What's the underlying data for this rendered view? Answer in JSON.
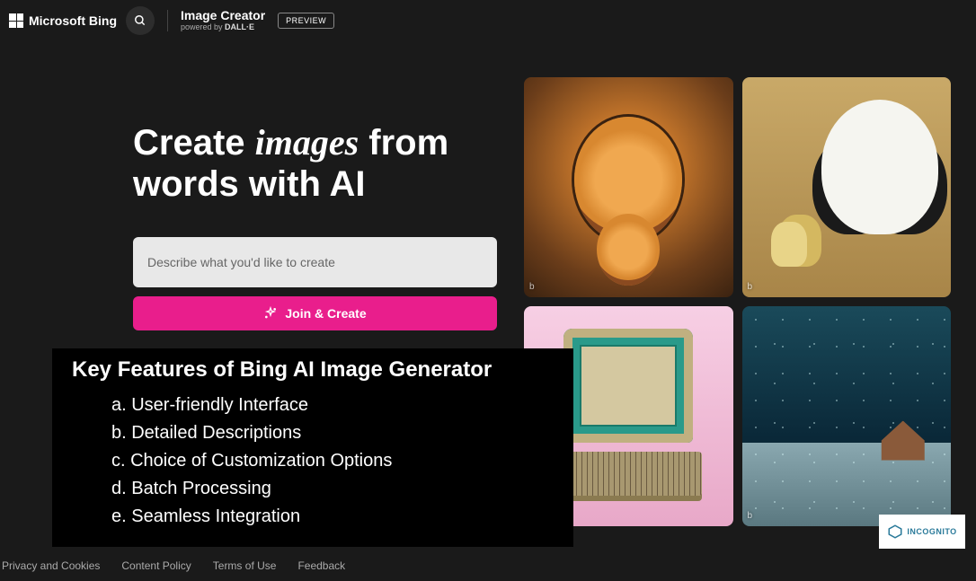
{
  "header": {
    "brand_logo_text": "Microsoft Bing",
    "product_title": "Image Creator",
    "product_subtitle_prefix": "powered by ",
    "product_subtitle_bold": "DALL·E",
    "preview_badge": "PREVIEW"
  },
  "hero": {
    "line1_pre": "Create ",
    "line1_italic": "images",
    "line1_post": " from",
    "line2": "words with AI"
  },
  "prompt": {
    "placeholder": "Describe what you'd like to create"
  },
  "cta": {
    "label": "Join & Create"
  },
  "features": {
    "title": "Key Features of Bing AI Image Generator",
    "items": [
      "a. User-friendly Interface",
      "b. Detailed Descriptions",
      "c. Choice of Customization Options",
      "d. Batch Processing",
      "e. Seamless Integration"
    ]
  },
  "gallery": {
    "badge": "b"
  },
  "footer": {
    "links": [
      "Privacy and Cookies",
      "Content Policy",
      "Terms of Use",
      "Feedback"
    ]
  },
  "watermark": {
    "text": "INCOGNITO"
  }
}
